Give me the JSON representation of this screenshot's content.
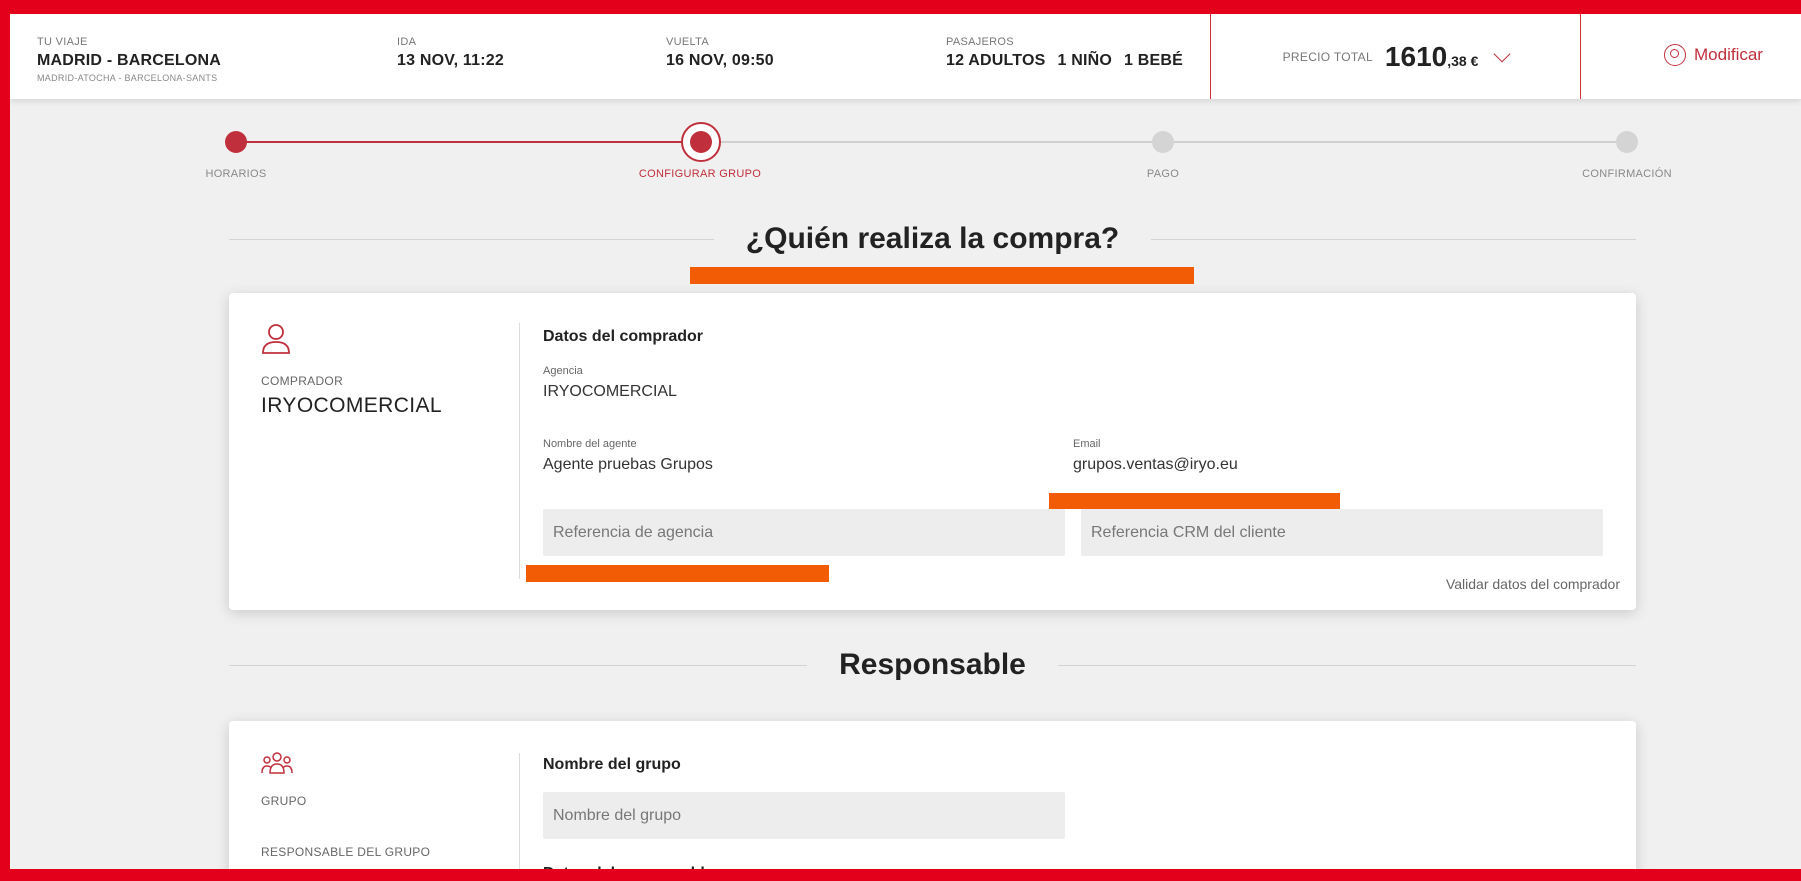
{
  "header": {
    "trip_label": "TU VIAJE",
    "trip_route": "MADRID - BARCELONA",
    "trip_stations": "MADRID-ATOCHA - BARCELONA-SANTS",
    "outbound_label": "IDA",
    "outbound_value": "13 NOV, 11:22",
    "return_label": "VUELTA",
    "return_value": "16 NOV, 09:50",
    "passengers_label": "PASAJEROS",
    "passengers": [
      "12 ADULTOS",
      "1 NIÑO",
      "1 BEBÉ"
    ],
    "price_label": "PRECIO TOTAL",
    "price_int": "1610",
    "price_dec": ",38 €",
    "modify_label": "Modificar"
  },
  "stepper": {
    "steps": [
      {
        "label": "HORARIOS",
        "state": "done"
      },
      {
        "label": "CONFIGURAR GRUPO",
        "state": "current"
      },
      {
        "label": "PAGO",
        "state": "pending"
      },
      {
        "label": "CONFIRMACIÓN",
        "state": "pending"
      }
    ]
  },
  "buyer_section": {
    "title": "¿Quién realiza la compra?",
    "role_label": "COMPRADOR",
    "buyer_name": "IRYOCOMERCIAL",
    "data_title": "Datos del comprador",
    "agency_label": "Agencia",
    "agency_value": "IRYOCOMERCIAL",
    "agent_label": "Nombre del agente",
    "agent_value": "Agente pruebas Grupos",
    "email_label": "Email",
    "email_value": "grupos.ventas@iryo.eu",
    "agency_ref_placeholder": "Referencia de agencia",
    "crm_ref_placeholder": "Referencia CRM del cliente",
    "validate_label": "Validar datos del comprador"
  },
  "responsible_section": {
    "title": "Responsable",
    "group_label": "GRUPO",
    "responsible_label": "RESPONSABLE DEL GRUPO",
    "group_name_title": "Nombre del grupo",
    "group_name_placeholder": "Nombre del grupo",
    "next_title": "Datos del responsable"
  },
  "colors": {
    "accent": "#c0303c",
    "frame": "#e3001b",
    "redaction": "#f25c05"
  }
}
